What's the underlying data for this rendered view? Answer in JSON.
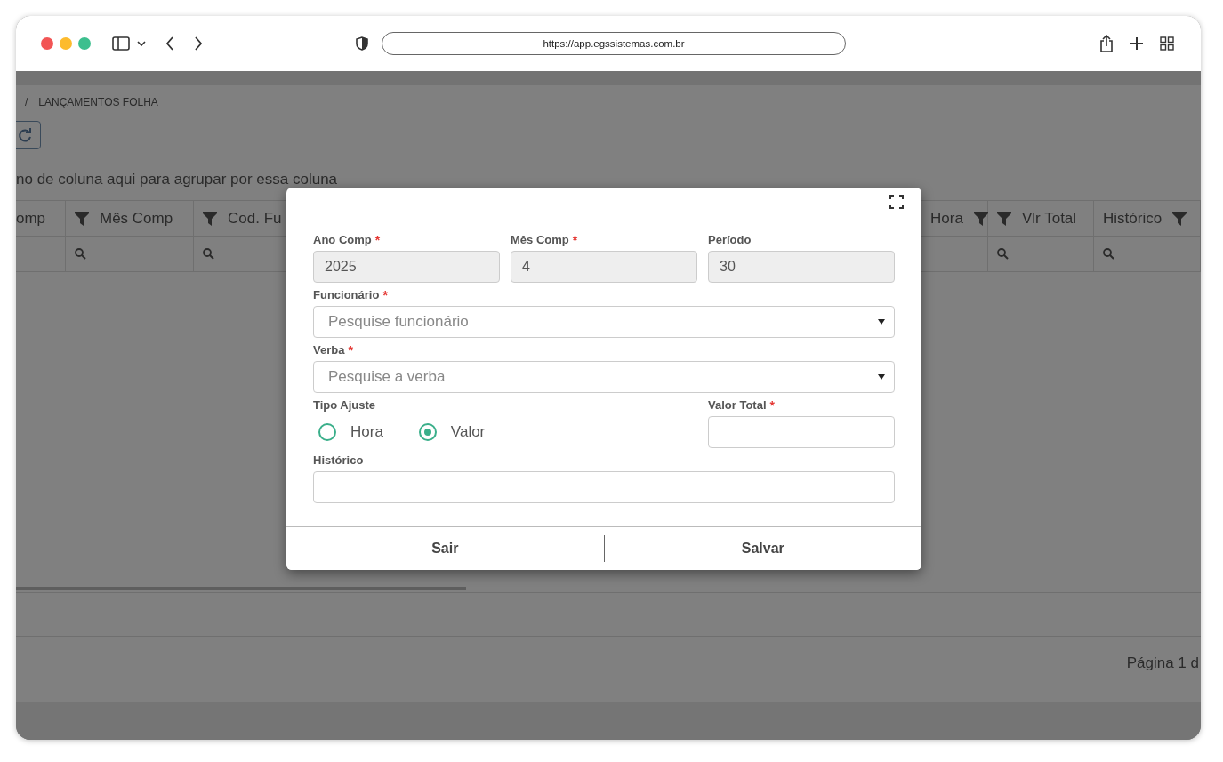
{
  "browser": {
    "url": "https://app.egssistemas.com.br"
  },
  "breadcrumb": {
    "separator": "/",
    "current": "LANÇAMENTOS FOLHA"
  },
  "group_hint": "no de coluna aqui para agrupar por essa coluna",
  "grid": {
    "columns": [
      {
        "label": "omp",
        "filter_left": false,
        "filter_right": false,
        "search_icon": false
      },
      {
        "label": "Mês Comp",
        "filter_left": true,
        "filter_right": false,
        "search_icon": true
      },
      {
        "label": "Cod. Fu",
        "filter_left": true,
        "filter_right": false,
        "search_icon": true
      },
      {
        "label": "Hora",
        "filter_left": false,
        "filter_right": true,
        "search_icon": false
      },
      {
        "label": "Vlr Total",
        "filter_left": true,
        "filter_right": false,
        "search_icon": true
      },
      {
        "label": "Histórico",
        "filter_left": false,
        "filter_right": true,
        "search_icon": true
      }
    ]
  },
  "pager": "Página 1 d",
  "modal": {
    "top_fields": [
      {
        "label": "Ano Comp",
        "required_mark": "*",
        "value": "2025",
        "disabled": true
      },
      {
        "label": "Mês Comp",
        "required_mark": "*",
        "value": "4",
        "disabled": true
      },
      {
        "label": "Período",
        "value": "30",
        "disabled": true
      }
    ],
    "employee": {
      "label": "Funcionário",
      "required_mark": "*",
      "placeholder": "Pesquise funcionário"
    },
    "verba": {
      "label": "Verba",
      "required_mark": "*",
      "placeholder": "Pesquise a verba"
    },
    "adjust_type": {
      "label": "Tipo Ajuste",
      "options": [
        {
          "label": "Hora",
          "selected": false
        },
        {
          "label": "Valor",
          "selected": true
        }
      ]
    },
    "total": {
      "label": "Valor Total",
      "required_mark": "*"
    },
    "history": {
      "label": "Histórico"
    },
    "buttons": [
      "Sair",
      "Salvar"
    ]
  }
}
